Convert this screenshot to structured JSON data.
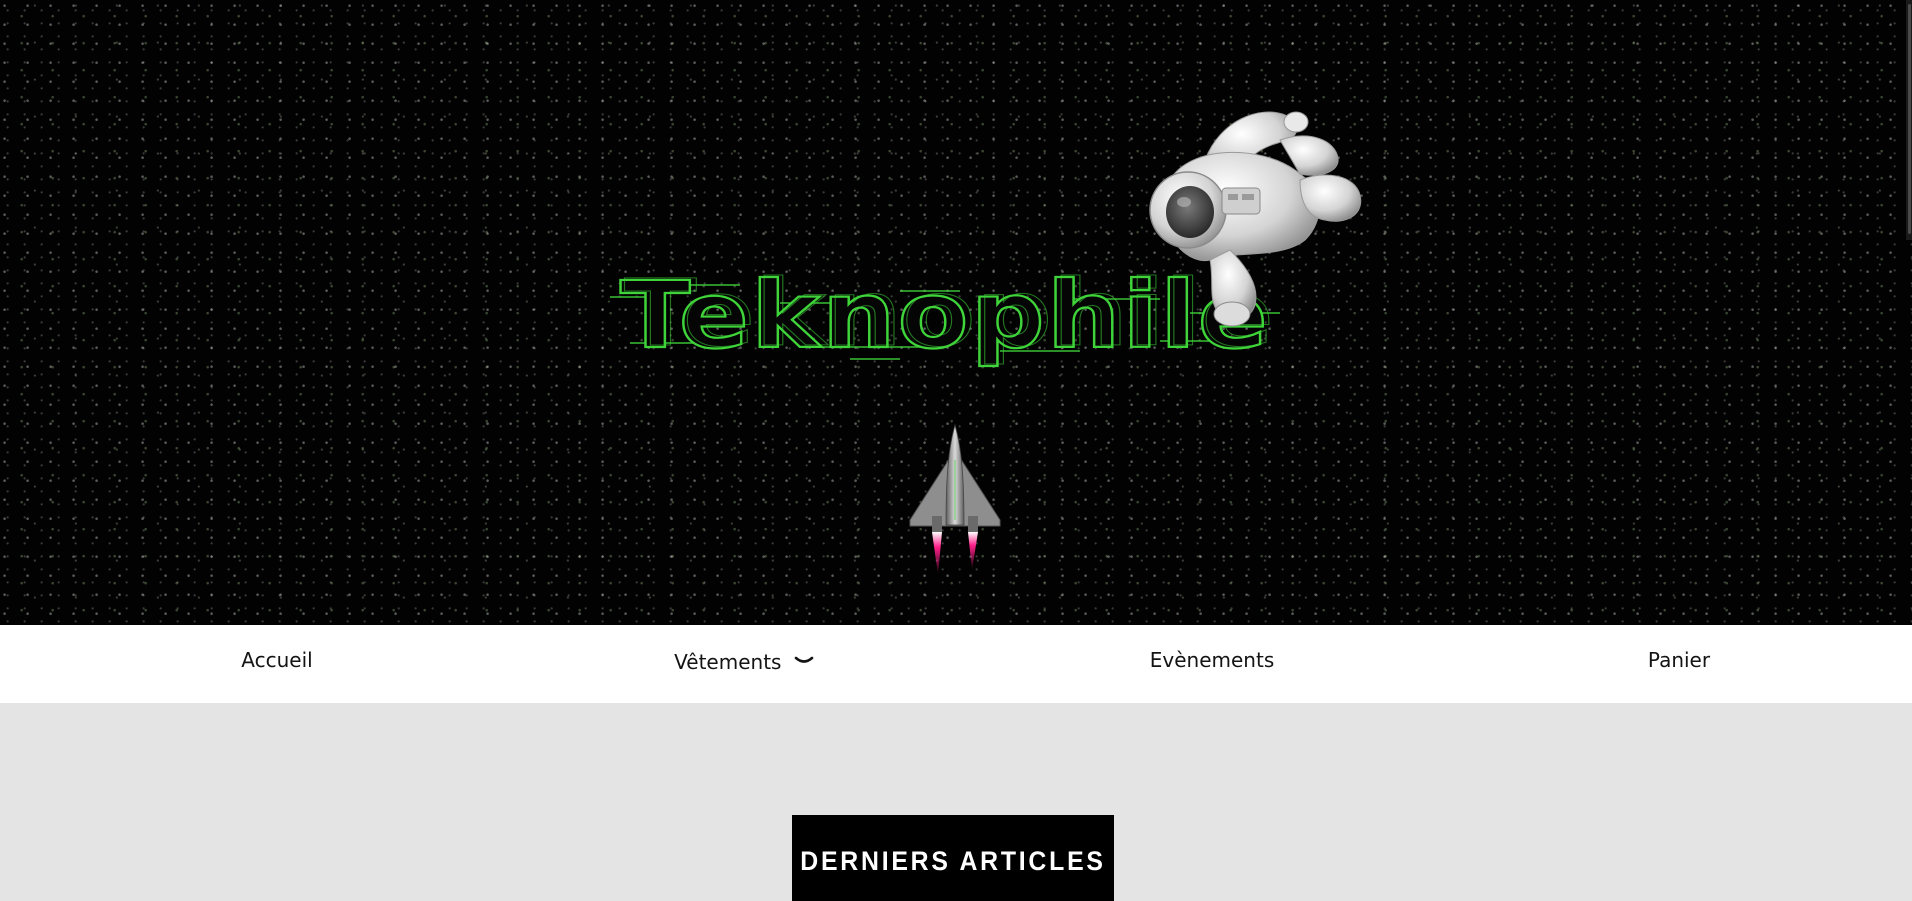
{
  "hero": {
    "logo_text": "Teknophile",
    "logo_color": "#3fd43a",
    "background_color": "#020202"
  },
  "nav": {
    "items": [
      {
        "label": "Accueil"
      },
      {
        "label": "Vêtements",
        "icon": "chevron-down-icon"
      },
      {
        "label": "Evènements"
      },
      {
        "label": "Panier"
      }
    ]
  },
  "main": {
    "section_title": "DERNIERS ARTICLES"
  },
  "colors": {
    "nav_bg": "#ffffff",
    "main_bg": "#e4e4e4",
    "badge_bg": "#000000",
    "accent_green": "#3fd43a",
    "flame": "#ff1f8a"
  }
}
